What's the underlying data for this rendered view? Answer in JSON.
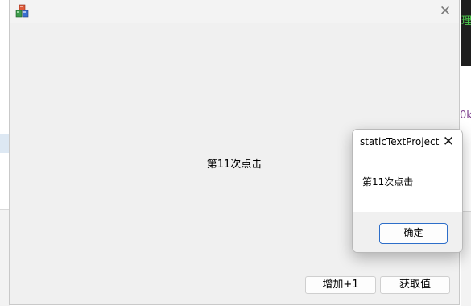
{
  "background": {
    "right_edge_text_green": "理",
    "right_edge_text_purple": "0k"
  },
  "main_window": {
    "app_icon": "colored-cubes-icon",
    "close_icon": "close-icon",
    "static_text": "第11次点击",
    "buttons": {
      "add_label": "增加+1",
      "get_label": "获取值"
    }
  },
  "message_box": {
    "title": "staticTextProject",
    "close_icon": "close-icon",
    "message": "第11次点击",
    "ok_label": "确定",
    "ok_border_color": "#2d6ec9"
  }
}
